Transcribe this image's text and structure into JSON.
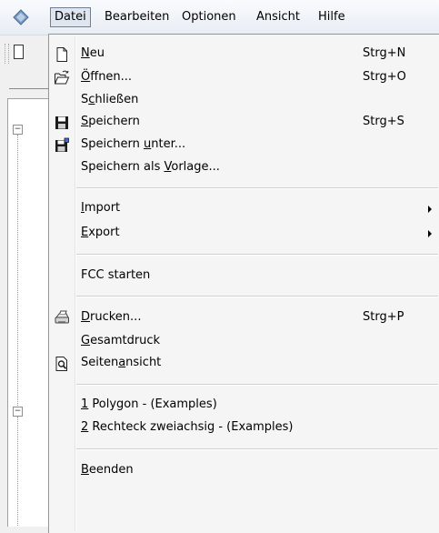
{
  "menubar": {
    "items": [
      {
        "label": "Datei"
      },
      {
        "label": "Bearbeiten"
      },
      {
        "label": "Optionen"
      },
      {
        "label": "Ansicht"
      },
      {
        "label": "Hilfe"
      }
    ]
  },
  "file_menu": {
    "new": {
      "label_pre": "",
      "label_acc": "N",
      "label_post": "eu",
      "shortcut": "Strg+N",
      "icon": "new-document-icon"
    },
    "open": {
      "label_pre": "",
      "label_acc": "Ö",
      "label_post": "ffnen...",
      "shortcut": "Strg+O",
      "icon": "open-folder-icon"
    },
    "close": {
      "label_pre": "S",
      "label_acc": "c",
      "label_post": "hließen"
    },
    "save": {
      "label_pre": "",
      "label_acc": "S",
      "label_post": "peichern",
      "shortcut": "Strg+S",
      "icon": "save-disk-icon"
    },
    "save_as": {
      "label_pre": "Speichern ",
      "label_acc": "u",
      "label_post": "nter...",
      "icon": "save-as-icon"
    },
    "save_tpl": {
      "label_pre": "Speichern als ",
      "label_acc": "V",
      "label_post": "orlage..."
    },
    "import": {
      "label_pre": "",
      "label_acc": "I",
      "label_post": "mport"
    },
    "export": {
      "label_pre": "",
      "label_acc": "E",
      "label_post": "xport"
    },
    "fcc": {
      "label": "FCC starten"
    },
    "print": {
      "label_pre": "",
      "label_acc": "D",
      "label_post": "rucken...",
      "shortcut": "Strg+P",
      "icon": "printer-icon"
    },
    "print_all": {
      "label_pre": "",
      "label_acc": "G",
      "label_post": "esamtdruck"
    },
    "preview": {
      "label_pre": "Seiten",
      "label_acc": "a",
      "label_post": "nsicht",
      "icon": "print-preview-icon"
    },
    "recent_1": {
      "label_pre": "",
      "label_acc": "1",
      "label_post": " Polygon - (Examples)"
    },
    "recent_2": {
      "label_pre": "",
      "label_acc": "2",
      "label_post": " Rechteck zweiachsig - (Examples)"
    },
    "exit": {
      "label_pre": "",
      "label_acc": "B",
      "label_post": "eenden"
    }
  }
}
